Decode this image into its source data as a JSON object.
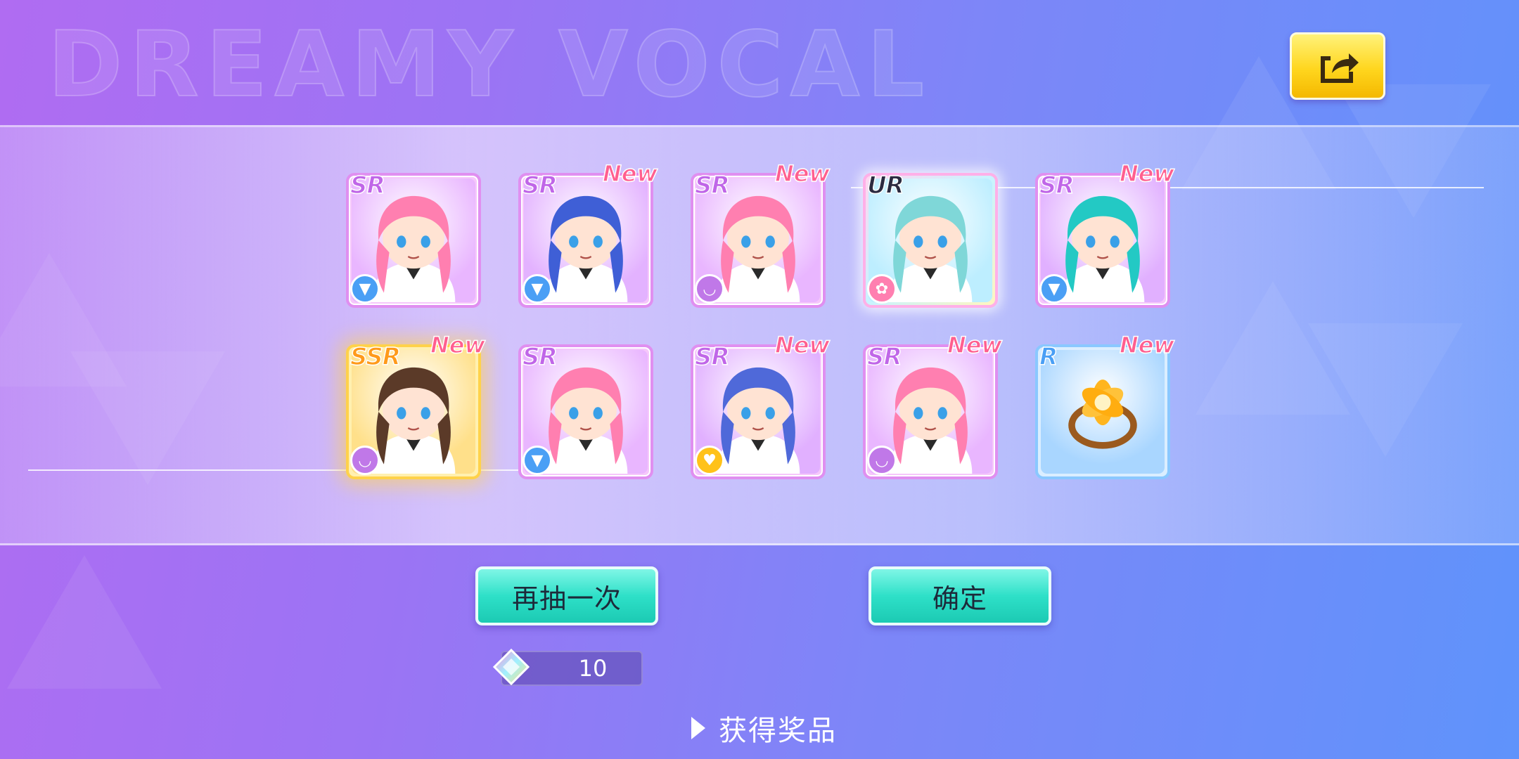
{
  "background_title": "DREAMY VOCAL",
  "share": {
    "icon": "share-export-icon"
  },
  "cards": [
    {
      "rarity": "SR",
      "is_new": false,
      "new_label": "",
      "attribute_icon": "tie-icon",
      "hair": "#ff7fb0",
      "bg": "#e9b6ff"
    },
    {
      "rarity": "SR",
      "is_new": true,
      "new_label": "New",
      "attribute_icon": "tie-icon",
      "hair": "#3f5fd6",
      "bg": "#e3b2ff"
    },
    {
      "rarity": "SR",
      "is_new": true,
      "new_label": "New",
      "attribute_icon": "lips-icon",
      "hair": "#ff7fb0",
      "bg": "#e9b6ff"
    },
    {
      "rarity": "UR",
      "is_new": false,
      "new_label": "",
      "attribute_icon": "rose-icon",
      "hair": "#7fd7d8",
      "bg": "#bdeeff"
    },
    {
      "rarity": "SR",
      "is_new": true,
      "new_label": "New",
      "attribute_icon": "tie-icon",
      "hair": "#23c9c4",
      "bg": "#e1b0ff"
    },
    {
      "rarity": "SSR",
      "is_new": true,
      "new_label": "New",
      "attribute_icon": "lips-icon",
      "hair": "#5b3a28",
      "bg": "#ffe08a"
    },
    {
      "rarity": "SR",
      "is_new": false,
      "new_label": "",
      "attribute_icon": "tie-icon",
      "hair": "#ff7fb0",
      "bg": "#e9b6ff"
    },
    {
      "rarity": "SR",
      "is_new": true,
      "new_label": "New",
      "attribute_icon": "heart-icon",
      "hair": "#4f69d9",
      "bg": "#e1b0ff"
    },
    {
      "rarity": "SR",
      "is_new": true,
      "new_label": "New",
      "attribute_icon": "lips-icon",
      "hair": "#ff7fb0",
      "bg": "#e9b6ff"
    },
    {
      "rarity": "R",
      "is_new": true,
      "new_label": "New",
      "attribute_icon": "",
      "hair": "",
      "bg": "#a9d6ff",
      "item_icon": "flower-ring-item-icon"
    }
  ],
  "buttons": {
    "draw_again": "再抽一次",
    "confirm": "确定"
  },
  "cost": {
    "icon": "gem-icon",
    "value": "10"
  },
  "reward_link": {
    "icon": "play-arrow-icon",
    "label": "获得奖品"
  }
}
